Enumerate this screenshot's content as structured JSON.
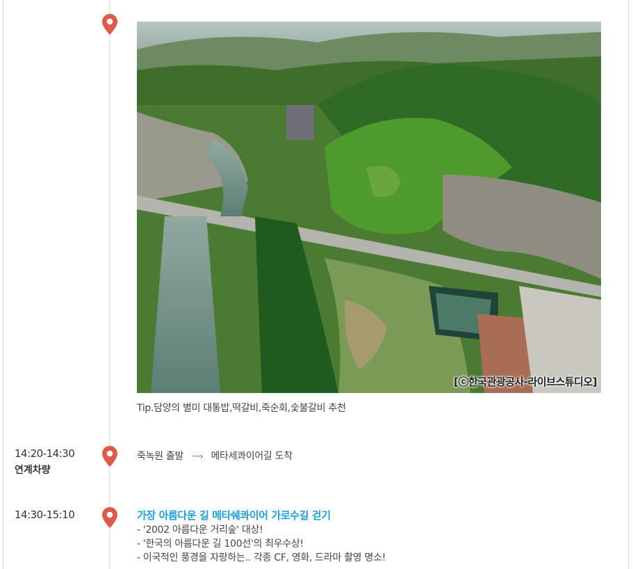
{
  "photo": {
    "credit": "[ⓒ한국관광공사-라이브스튜디오]"
  },
  "caption": "Tip.담양의 별미 대통밥,떡갈비,죽순회,숯불갈비 추천",
  "schedule": [
    {
      "time": "14:20-14:30",
      "subtitle": "연계차량",
      "from": "죽녹원 출발",
      "arrow": "····›",
      "to": "메타세콰이어길 도착"
    },
    {
      "time": "14:30-15:10",
      "title": "가장 아름다운 길 메타쉐콰이어 가로수길 걷기",
      "bullets": [
        "- '2002 아름다운 거리숲' 대상!",
        "- '한국의 아름다운 길 100선'의 최우수상!",
        "- 이국적인 풍경을 자랑하는.. 각종 CF, 영화, 드라마 촬영 명소!"
      ]
    }
  ],
  "colors": {
    "pin": "#e05a4a",
    "highlight": "#1e9fdc",
    "line": "#dcdcdc"
  }
}
